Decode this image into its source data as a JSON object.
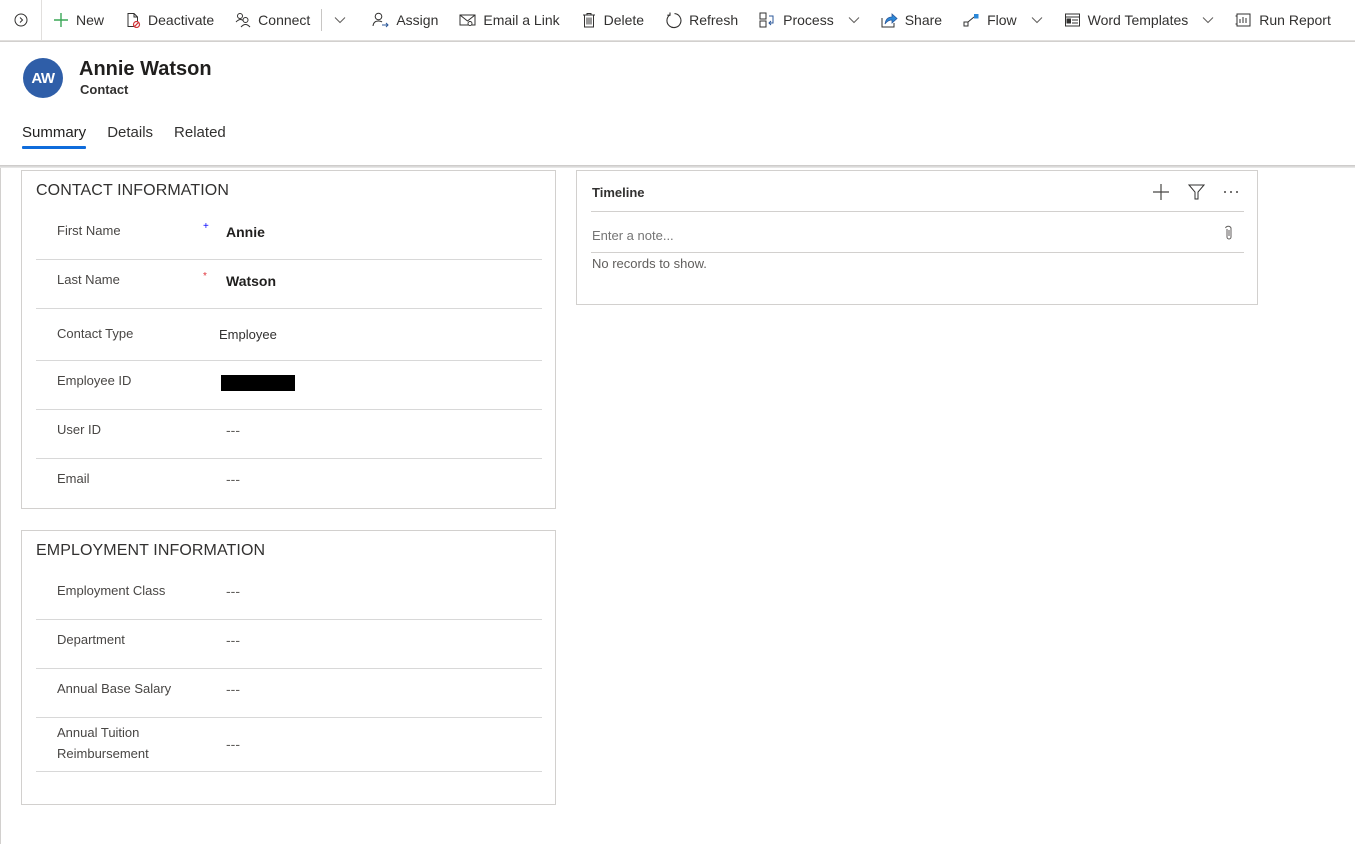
{
  "command_bar": {
    "items": [
      {
        "label": "New",
        "icon": "plus-icon"
      },
      {
        "label": "Deactivate",
        "icon": "deactivate-icon"
      },
      {
        "label": "Connect",
        "icon": "connect-icon"
      },
      {
        "label": "Assign",
        "icon": "assign-icon"
      },
      {
        "label": "Email a Link",
        "icon": "email-link-icon"
      },
      {
        "label": "Delete",
        "icon": "trash-icon"
      },
      {
        "label": "Refresh",
        "icon": "refresh-icon"
      },
      {
        "label": "Process",
        "icon": "process-icon"
      },
      {
        "label": "Share",
        "icon": "share-icon"
      },
      {
        "label": "Flow",
        "icon": "flow-icon"
      },
      {
        "label": "Word Templates",
        "icon": "word-template-icon"
      },
      {
        "label": "Run Report",
        "icon": "report-icon"
      }
    ]
  },
  "header": {
    "avatar_initials": "AW",
    "avatar_color": "#2f5ea8",
    "title": "Annie Watson",
    "subtitle": "Contact",
    "tabs": [
      {
        "label": "Summary",
        "active": true
      },
      {
        "label": "Details",
        "active": false
      },
      {
        "label": "Related",
        "active": false
      }
    ]
  },
  "contact_information": {
    "title": "CONTACT INFORMATION",
    "fields": [
      {
        "label": "First Name",
        "required_marker": "+",
        "value": "Annie"
      },
      {
        "label": "Last Name",
        "required_marker": "*",
        "value": "Watson"
      },
      {
        "label": "Contact Type",
        "value": "Employee"
      },
      {
        "label": "Employee ID",
        "value": "[redacted]"
      },
      {
        "label": "User ID",
        "value": "---"
      },
      {
        "label": "Email",
        "value": "---"
      }
    ]
  },
  "employment_information": {
    "title": "EMPLOYMENT INFORMATION",
    "fields": [
      {
        "label": "Employment Class",
        "value": "---"
      },
      {
        "label": "Department",
        "value": "---"
      },
      {
        "label": "Annual Base Salary",
        "value": "---"
      },
      {
        "label": "Annual Tuition Reimbursement",
        "value": "---"
      }
    ]
  },
  "timeline": {
    "title": "Timeline",
    "note_placeholder": "Enter a note...",
    "empty_text": "No records to show."
  },
  "colors": {
    "accent": "#0f6cdb",
    "required_recommended": "#0000ff",
    "required": "#e0333a",
    "new_plus": "#3aa757"
  }
}
